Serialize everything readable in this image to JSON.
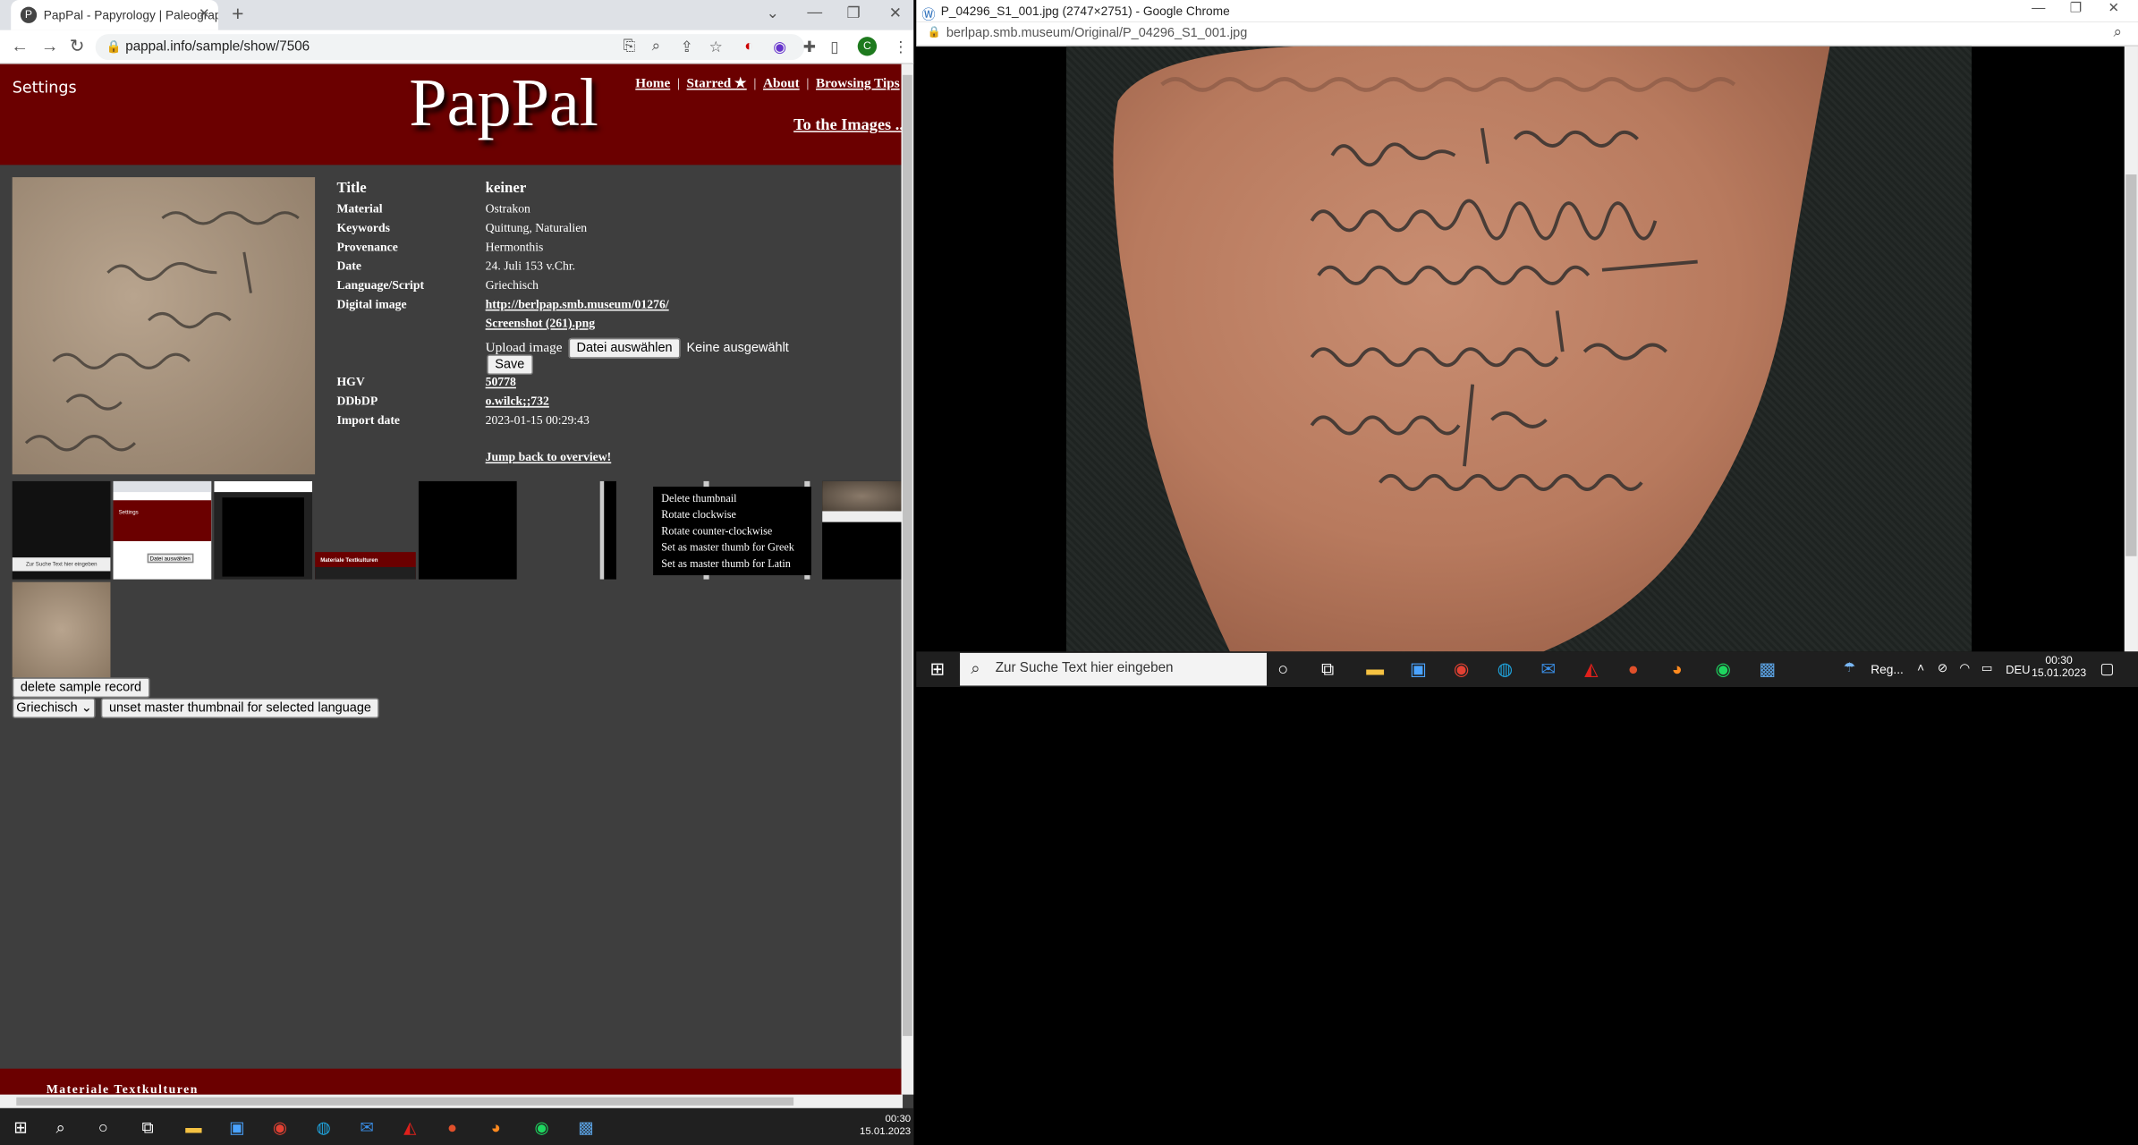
{
  "left_window": {
    "tab_title": "PapPal - Papyrology | Paleograph",
    "url": "pappal.info/sample/show/7506",
    "profile_initial": "C",
    "header": {
      "settings": "Settings",
      "logo": "PapPal",
      "nav": [
        "Home",
        "Starred ★",
        "About",
        "Browsing Tips"
      ],
      "to_images": "To the Images ..."
    },
    "record": {
      "title_label": "Title",
      "title_value": "keiner",
      "rows": [
        {
          "label": "Material",
          "value": "Ostrakon"
        },
        {
          "label": "Keywords",
          "value": "Quittung, Naturalien"
        },
        {
          "label": "Provenance",
          "value": "Hermonthis"
        },
        {
          "label": "Date",
          "value": "24. Juli 153 v.Chr."
        },
        {
          "label": "Language/Script",
          "value": "Griechisch"
        }
      ],
      "digital_image_label": "Digital image",
      "digital_image_link": "http://berlpap.smb.museum/01276/",
      "screenshot_link": "Screenshot (261).png",
      "upload_label": "Upload image",
      "file_button": "Datei auswählen",
      "no_file": "Keine ausgewählt",
      "save_button": "Save",
      "hgv_label": "HGV",
      "hgv_value": "50778",
      "ddbdp_label": "DDbDP",
      "ddbdp_value": "o.wilck;;732",
      "import_label": "Import date",
      "import_value": "2023-01-15 00:29:43",
      "jump_back": "Jump back to overview!"
    },
    "thumb_labels": {
      "settings": "Settings",
      "search_placeholder": "Zur Suche Text hier eingeben",
      "file_button": "Datei auswählen",
      "materiale": "Materiale Textkulturen"
    },
    "context_menu": [
      "Delete thumbnail",
      "Rotate clockwise",
      "Rotate counter-clockwise",
      "Set as master thumb for Greek",
      "Set as master thumb for Latin"
    ],
    "delete_button": "delete sample record",
    "language_select": "Griechisch",
    "unset_button": "unset master thumbnail for selected language",
    "footer": "Materiale Textkulturen",
    "taskbar_time": "00:30",
    "taskbar_date": "15.01.2023"
  },
  "right_window": {
    "title": "P_04296_S1_001.jpg (2747×2751) - Google Chrome",
    "url": "berlpap.smb.museum/Original/P_04296_S1_001.jpg",
    "taskbar": {
      "search_placeholder": "Zur Suche Text hier eingeben",
      "weather": "Reg...",
      "lang": "DEU",
      "time": "00:30",
      "date": "15.01.2023"
    }
  }
}
